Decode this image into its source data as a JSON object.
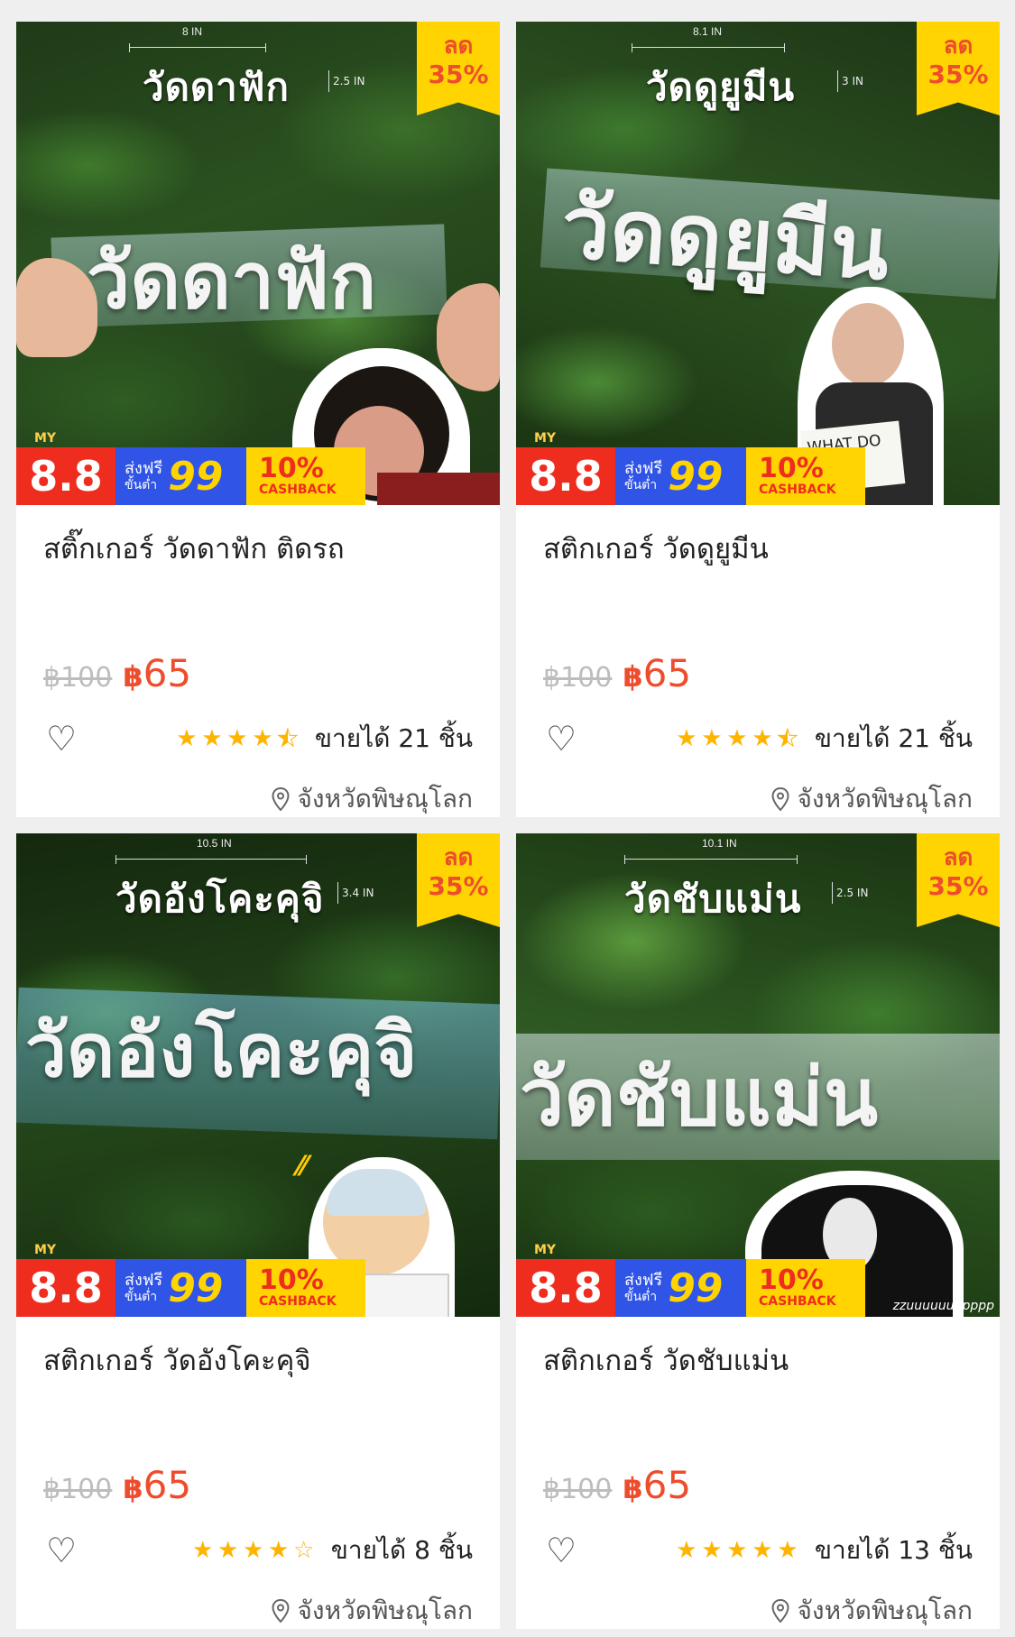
{
  "products": [
    {
      "image": {
        "small_title": "วัดดาฟัก",
        "width_label": "8 IN",
        "height_label": "2.5 IN",
        "big_text": "วัดดาฟัก"
      },
      "discount": {
        "line1": "ลด",
        "line2": "35%"
      },
      "promo": {
        "badge": "8.8",
        "my": "MY",
        "free_ship": "ส่งฟรี",
        "min_spend": "ขั้นต่ำ",
        "amount": "99",
        "cashback_pct": "10%",
        "cashback_label": "CASHBACK"
      },
      "title": "สติ๊กเกอร์ วัดดาฟัก ติดรถ",
      "old_price": "฿100",
      "currency": "฿",
      "price": "65",
      "rating": 4.5,
      "sold": "ขายได้ 21 ชิ้น",
      "location": "จังหวัดพิษณุโลก"
    },
    {
      "image": {
        "small_title": "วัดดูยูมีน",
        "width_label": "8.1 IN",
        "height_label": "3 IN",
        "big_text": "วัดดูยูมีน",
        "sign_text": "WHAT DO YOU MEAN?"
      },
      "discount": {
        "line1": "ลด",
        "line2": "35%"
      },
      "promo": {
        "badge": "8.8",
        "my": "MY",
        "free_ship": "ส่งฟรี",
        "min_spend": "ขั้นต่ำ",
        "amount": "99",
        "cashback_pct": "10%",
        "cashback_label": "CASHBACK"
      },
      "title": "สติกเกอร์ วัดดูยูมีน",
      "old_price": "฿100",
      "currency": "฿",
      "price": "65",
      "rating": 4.5,
      "sold": "ขายได้ 21 ชิ้น",
      "location": "จังหวัดพิษณุโลก"
    },
    {
      "image": {
        "small_title": "วัดอังโคะคุจิ",
        "width_label": "10.5 IN",
        "height_label": "3.4 IN",
        "big_text": "วัดอังโคะคุจิ"
      },
      "discount": {
        "line1": "ลด",
        "line2": "35%"
      },
      "promo": {
        "badge": "8.8",
        "my": "MY",
        "free_ship": "ส่งฟรี",
        "min_spend": "ขั้นต่ำ",
        "amount": "99",
        "cashback_pct": "10%",
        "cashback_label": "CASHBACK"
      },
      "title": "สติกเกอร์ วัดอังโคะคุจิ",
      "old_price": "฿100",
      "currency": "฿",
      "price": "65",
      "rating": 4,
      "sold": "ขายได้ 8 ชิ้น",
      "location": "จังหวัดพิษณุโลก"
    },
    {
      "image": {
        "small_title": "วัดชับแม่น",
        "width_label": "10.1 IN",
        "height_label": "2.5 IN",
        "big_text": "วัดชับแม่น",
        "caption": "zzuuuuuuppppp"
      },
      "discount": {
        "line1": "ลด",
        "line2": "35%"
      },
      "promo": {
        "badge": "8.8",
        "my": "MY",
        "free_ship": "ส่งฟรี",
        "min_spend": "ขั้นต่ำ",
        "amount": "99",
        "cashback_pct": "10%",
        "cashback_label": "CASHBACK"
      },
      "title": "สติกเกอร์ วัดชับแม่น",
      "old_price": "฿100",
      "currency": "฿",
      "price": "65",
      "rating": 5,
      "sold": "ขายได้ 13 ชิ้น",
      "location": "จังหวัดพิษณุโลก"
    }
  ],
  "colors": {
    "accent": "#ee4d2d",
    "star": "#ffb400",
    "discount_bg": "#ffd400",
    "page_bg": "#efefef"
  }
}
